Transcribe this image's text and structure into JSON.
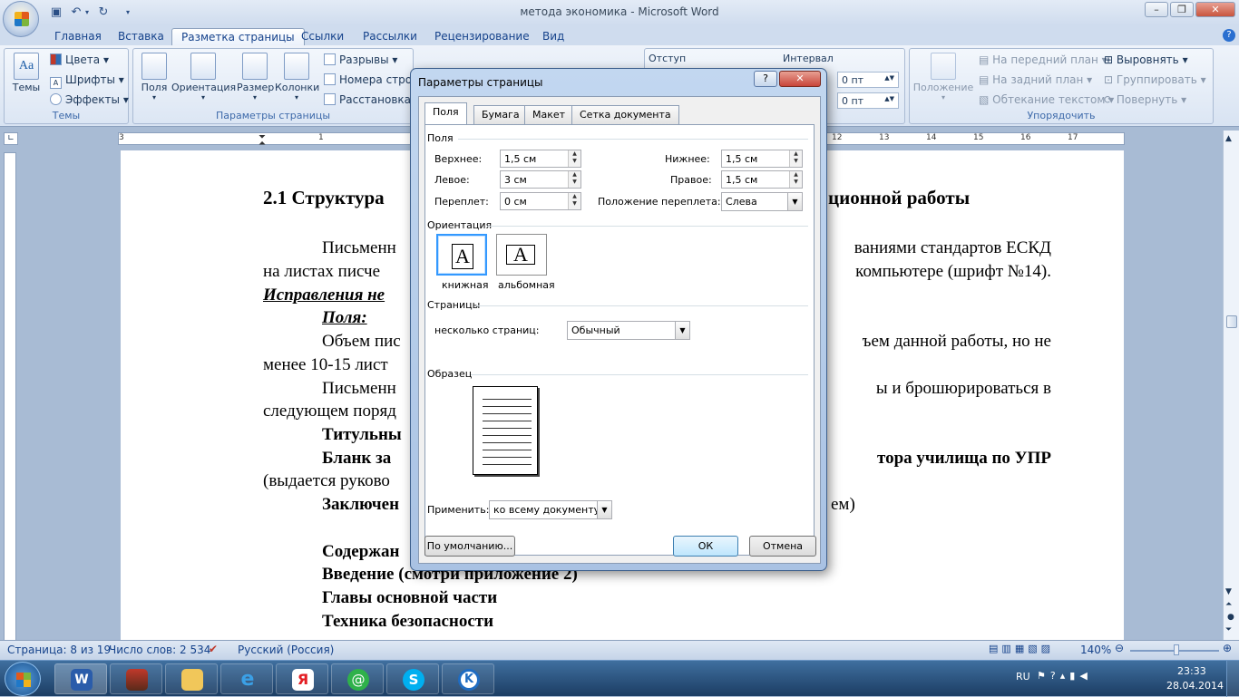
{
  "window": {
    "title": "метода экономика - Microsoft Word"
  },
  "ribbon_tabs": [
    "Главная",
    "Вставка",
    "Разметка страницы",
    "Ссылки",
    "Рассылки",
    "Рецензирование",
    "Вид"
  ],
  "ribbon": {
    "themes": {
      "big": "Темы",
      "colors": "Цвета",
      "fonts": "Шрифты",
      "effects": "Эффекты",
      "group": "Темы"
    },
    "page_setup": {
      "fields": "Поля",
      "orientation": "Ориентация",
      "size": "Размер",
      "columns": "Колонки",
      "breaks": "Разрывы",
      "line_numbers": "Номера строк",
      "hyphenation": "Расстановка пере",
      "group": "Параметры страницы"
    },
    "paragraph": {
      "indent": "Отступ",
      "spacing": "Интервал",
      "before": "0 пт",
      "after": "0 пт"
    },
    "arrange": {
      "position": "Положение",
      "bring_front": "На передний план",
      "send_back": "На задний план",
      "wrap": "Обтекание текстом",
      "align": "Выровнять",
      "group_btn": "Группировать",
      "rotate": "Повернуть",
      "group": "Упорядочить"
    }
  },
  "ruler": {
    "left_ticks": [
      "3",
      "1",
      "1",
      "2"
    ],
    "right_ticks": [
      "12",
      "13",
      "14",
      "15",
      "16",
      "17"
    ]
  },
  "document": {
    "heading_left": "2.1 Структура",
    "heading_right": "ционной работы",
    "lines": [
      {
        "l": "Письменн",
        "r": "ваниями стандартов ЕСКД"
      },
      {
        "l": "на листах писче",
        "r": "компьютере (шрифт №14)."
      },
      {
        "l": "Исправления не",
        "r": ""
      },
      {
        "l": "Поля:",
        "r": ""
      },
      {
        "l": "Объем пис",
        "r": "ъем данной работы, но не"
      },
      {
        "l": "менее 10-15 лист",
        "r": ""
      },
      {
        "l": "Письменн",
        "r": "ы и брошюрироваться в"
      },
      {
        "l": "следующем поряд",
        "r": ""
      },
      {
        "l": "Титульны",
        "r": ""
      },
      {
        "l": "Бланк за",
        "r": "тора училища по УПР"
      },
      {
        "l": "(выдается руково",
        "r": ""
      },
      {
        "l": "Заключен",
        "r": "ем)"
      },
      {
        "l": "Содержан",
        "r": ""
      },
      {
        "l": "Введение (смотри приложение 2)",
        "r": ""
      },
      {
        "l": "Главы основной части",
        "r": ""
      },
      {
        "l": "Техника безопасности",
        "r": ""
      }
    ]
  },
  "dialog": {
    "title": "Параметры страницы",
    "tabs": [
      "Поля",
      "Бумага",
      "Макет",
      "Сетка документа"
    ],
    "fields_section": "Поля",
    "top_label": "Верхнее:",
    "top_value": "1,5 см",
    "bottom_label": "Нижнее:",
    "bottom_value": "1,5 см",
    "left_label": "Левое:",
    "left_value": "3 см",
    "right_label": "Правое:",
    "right_value": "1,5 см",
    "gutter_label": "Переплет:",
    "gutter_value": "0 см",
    "gutter_pos_label": "Положение переплета:",
    "gutter_pos_value": "Слева",
    "orientation_section": "Ориентация",
    "portrait": "книжная",
    "landscape": "альбомная",
    "pages_section": "Страницы",
    "multiple_pages_label": "несколько страниц:",
    "multiple_pages_value": "Обычный",
    "preview_section": "Образец",
    "apply_label": "Применить:",
    "apply_value": "ко всему документу",
    "default_btn": "По умолчанию...",
    "ok_btn": "ОК",
    "cancel_btn": "Отмена"
  },
  "status": {
    "page": "Страница: 8 из 19",
    "words": "Число слов: 2 534",
    "language": "Русский (Россия)",
    "zoom": "140%"
  },
  "tray": {
    "lang": "RU",
    "time": "23:33",
    "date": "28.04.2014"
  }
}
